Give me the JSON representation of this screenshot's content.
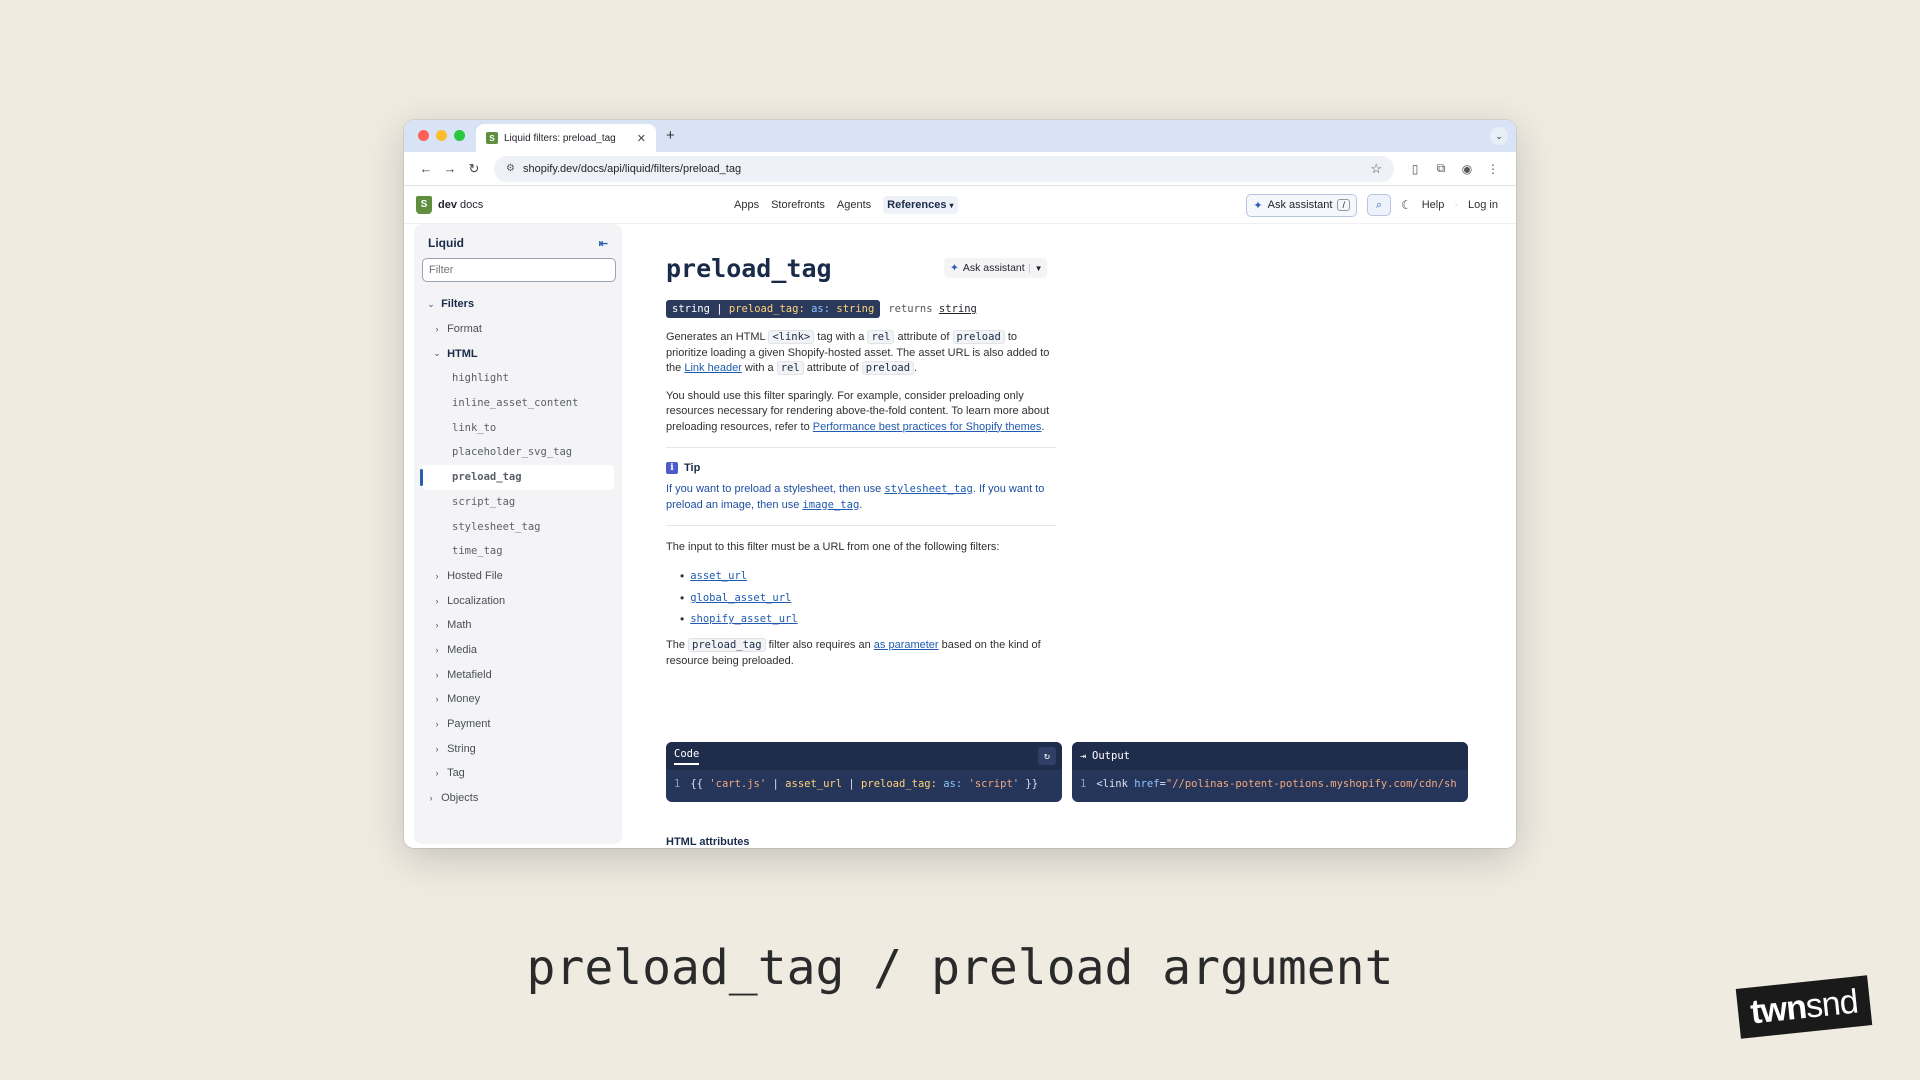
{
  "browser": {
    "tab_title": "Liquid filters: preload_tag",
    "url": "shopify.dev/docs/api/liquid/filters/preload_tag",
    "new_tab": "+"
  },
  "header": {
    "logo_bold": "dev",
    "logo_rest": " docs",
    "nav": [
      "Apps",
      "Storefronts",
      "Agents",
      "References"
    ],
    "ask_assistant": "Ask assistant",
    "shortcut": "/",
    "help": "Help",
    "login": "Log in"
  },
  "sidebar": {
    "title": "Liquid",
    "filter_placeholder": "Filter",
    "items": [
      {
        "label": "Filters",
        "level": 0,
        "chev": "⌄",
        "style": "bold"
      },
      {
        "label": "Format",
        "level": 1,
        "chev": "›"
      },
      {
        "label": "HTML",
        "level": 1,
        "chev": "⌄",
        "style": "bold"
      },
      {
        "label": "highlight",
        "level": 2,
        "code": true
      },
      {
        "label": "inline_asset_content",
        "level": 2,
        "code": true
      },
      {
        "label": "link_to",
        "level": 2,
        "code": true
      },
      {
        "label": "placeholder_svg_tag",
        "level": 2,
        "code": true
      },
      {
        "label": "preload_tag",
        "level": 2,
        "code": true,
        "selected": true
      },
      {
        "label": "script_tag",
        "level": 2,
        "code": true
      },
      {
        "label": "stylesheet_tag",
        "level": 2,
        "code": true
      },
      {
        "label": "time_tag",
        "level": 2,
        "code": true
      },
      {
        "label": "Hosted File",
        "level": 1,
        "chev": "›"
      },
      {
        "label": "Localization",
        "level": 1,
        "chev": "›"
      },
      {
        "label": "Math",
        "level": 1,
        "chev": "›"
      },
      {
        "label": "Media",
        "level": 1,
        "chev": "›"
      },
      {
        "label": "Metafield",
        "level": 1,
        "chev": "›"
      },
      {
        "label": "Money",
        "level": 1,
        "chev": "›"
      },
      {
        "label": "Payment",
        "level": 1,
        "chev": "›"
      },
      {
        "label": "String",
        "level": 1,
        "chev": "›"
      },
      {
        "label": "Tag",
        "level": 1,
        "chev": "›"
      },
      {
        "label": "Objects",
        "level": 0,
        "chev": "›"
      }
    ]
  },
  "main": {
    "title": "preload_tag",
    "ask_assistant": "Ask assistant",
    "signature": {
      "p1": "string | ",
      "p2": "preload_tag: ",
      "p3": "as: ",
      "p4": "string",
      "returns": "returns",
      "return_type": "string"
    },
    "para1": {
      "t1": "Generates an HTML ",
      "c1": "<link>",
      "t2": " tag with a ",
      "c2": "rel",
      "t3": " attribute of ",
      "c3": "preload",
      "t4": " to prioritize loading a given Shopify-hosted asset. The asset URL is also added to the ",
      "link": "Link header",
      "t5": " with a ",
      "c4": "rel",
      "t6": " attribute of ",
      "c5": "preload",
      "t7": "."
    },
    "para2": {
      "text": "You should use this filter sparingly. For example, consider preloading only resources necessary for rendering above-the-fold content. To learn more about preloading resources, refer to ",
      "link": "Performance best practices for Shopify themes",
      "end": "."
    },
    "tip": {
      "title": "Tip",
      "t1": "If you want to preload a stylesheet, then use ",
      "link1": "stylesheet_tag",
      "t2": ". If you want to preload an image, then use ",
      "link2": "image_tag",
      "t3": "."
    },
    "para3": "The input to this filter must be a URL from one of the following filters:",
    "list": [
      "asset_url",
      "global_asset_url",
      "shopify_asset_url"
    ],
    "para4": {
      "t1": "The ",
      "c1": "preload_tag",
      "t2": " filter also requires an ",
      "link": "as parameter",
      "t3": " based on the kind of resource being preloaded."
    },
    "code": {
      "tab": "Code",
      "line_no": "1",
      "open": "{{ ",
      "s1": "'cart.js'",
      "pipe1": " | ",
      "f1": "asset_url",
      "pipe2": " | ",
      "f2": "preload_tag:",
      "a1": " as:",
      "s2": " 'script'",
      "close": " }}"
    },
    "output": {
      "tab": "Output",
      "line_no": "1",
      "tag": "<link ",
      "attr": "href",
      "eq": "=",
      "val": "\"//polinas-potent-potions.myshopify.com/cdn/sh"
    },
    "next_heading": "HTML attributes"
  },
  "slide": {
    "caption": "preload_tag / preload argument",
    "brand_a": "twn",
    "brand_b": "snd"
  },
  "colors": {
    "accent": "#2a5fb0",
    "code_bg": "#26355a",
    "page_bg": "#efebe1",
    "shopify_green": "#5e8e3e"
  }
}
